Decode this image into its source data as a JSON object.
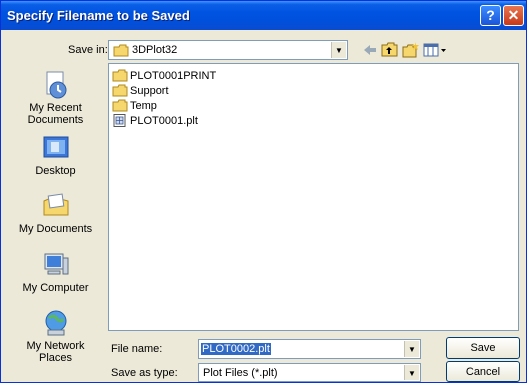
{
  "window": {
    "title": "Specify Filename to be Saved"
  },
  "toolbar": {
    "save_in_label": "Save in:",
    "save_in_value": "3DPlot32"
  },
  "places": [
    {
      "label1": "My Recent",
      "label2": "Documents",
      "icon": "recent-documents-icon"
    },
    {
      "label1": "Desktop",
      "label2": "",
      "icon": "desktop-icon"
    },
    {
      "label1": "My Documents",
      "label2": "",
      "icon": "my-documents-icon"
    },
    {
      "label1": "My Computer",
      "label2": "",
      "icon": "my-computer-icon"
    },
    {
      "label1": "My Network",
      "label2": "Places",
      "icon": "network-places-icon"
    }
  ],
  "files": [
    {
      "name": "PLOT0001PRINT",
      "type": "folder"
    },
    {
      "name": "Support",
      "type": "folder"
    },
    {
      "name": "Temp",
      "type": "folder"
    },
    {
      "name": "PLOT0001.plt",
      "type": "file"
    }
  ],
  "form": {
    "filename_label": "File name:",
    "filename_value": "PLOT0002.plt",
    "type_label": "Save as type:",
    "type_value": "Plot Files (*.plt)"
  },
  "buttons": {
    "save": "Save",
    "cancel": "Cancel"
  },
  "colors": {
    "title_bar": "#0054e3",
    "selection": "#316ac5",
    "window_bg": "#ece9d8"
  }
}
